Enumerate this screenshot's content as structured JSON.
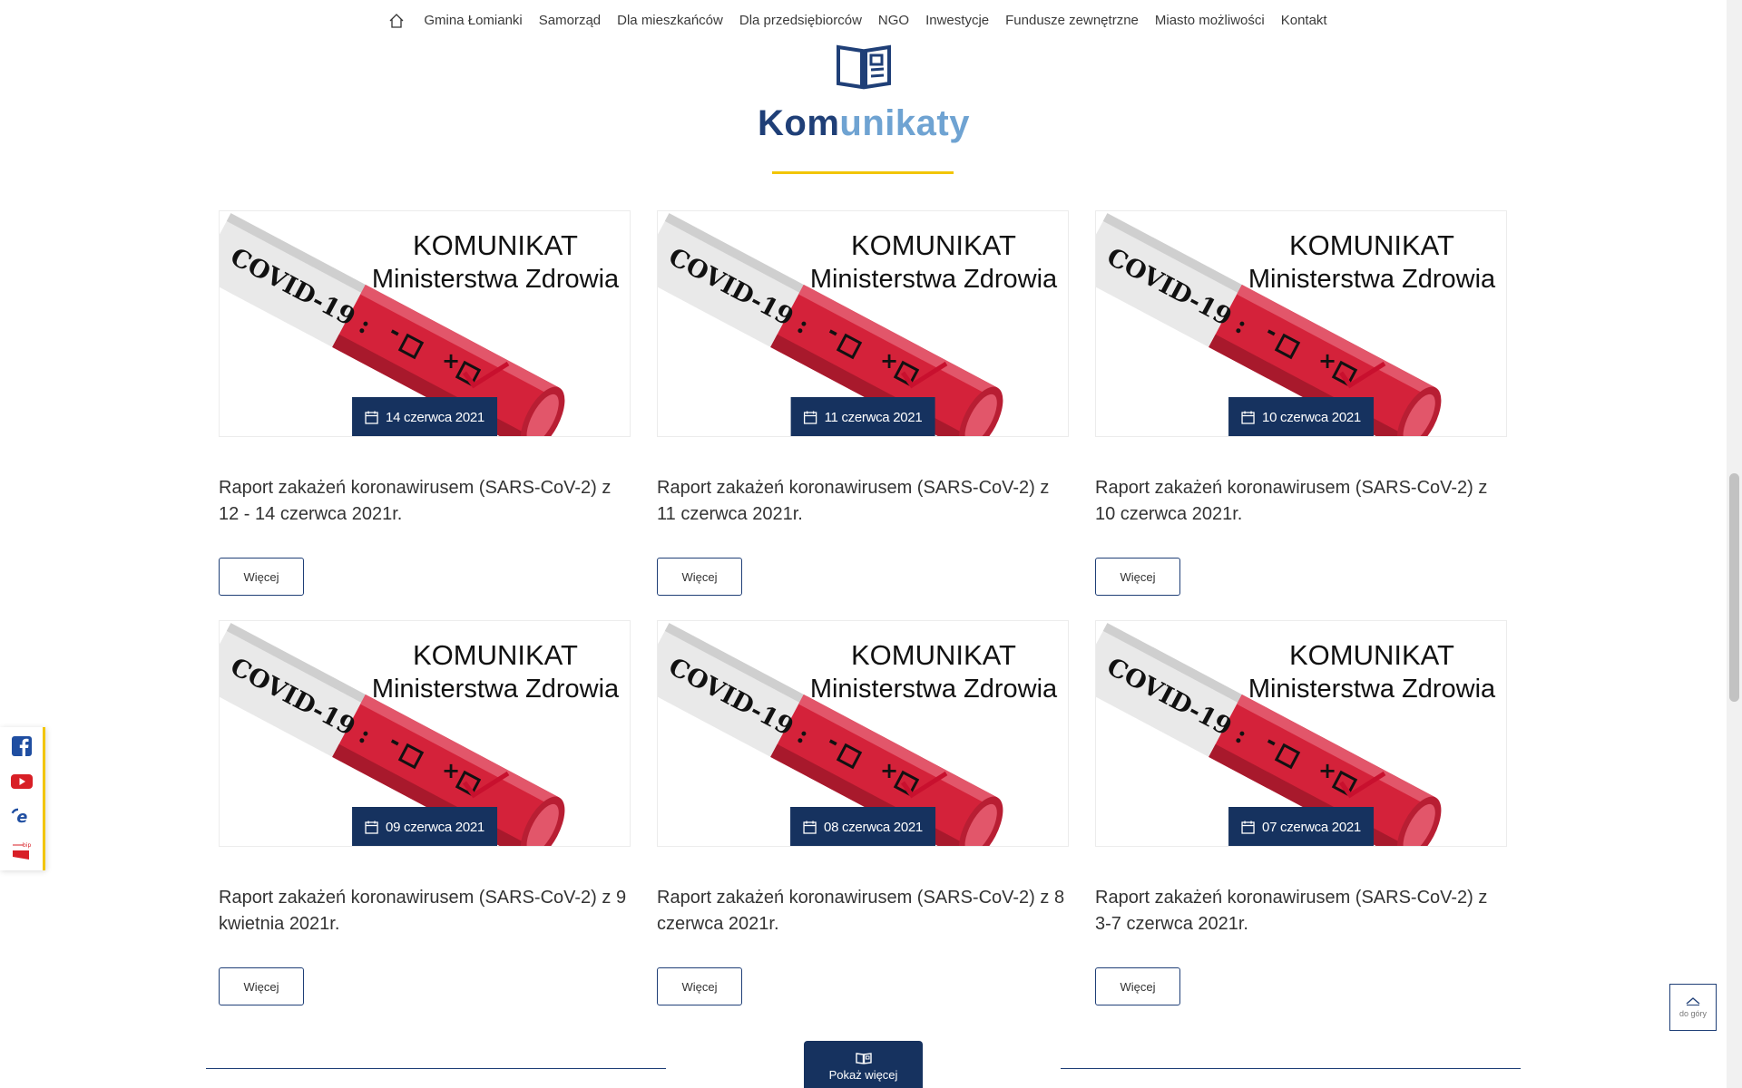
{
  "nav": {
    "items": [
      "Gmina Łomianki",
      "Samorząd",
      "Dla mieszkańców",
      "Dla przedsiębiorców",
      "NGO",
      "Inwestycje",
      "Fundusze zewnętrzne",
      "Miasto możliwości",
      "Kontakt"
    ]
  },
  "section": {
    "title_part1": "Kom",
    "title_part2": "unikaty"
  },
  "thumb_text": {
    "line1": "KOMUNIKAT",
    "line2": "Ministerstwa Zdrowia",
    "tube": "COVID-19 :",
    "neg": "-",
    "pos": "+"
  },
  "cards": [
    {
      "date": "14 czerwca 2021",
      "title": "Raport zakażeń koronawirusem (SARS-CoV-2) z 12 - 14 czerwca 2021r.",
      "button": "Więcej"
    },
    {
      "date": "11 czerwca 2021",
      "title": "Raport zakażeń koronawirusem (SARS-CoV-2) z 11 czerwca 2021r.",
      "button": "Więcej"
    },
    {
      "date": "10 czerwca 2021",
      "title": "Raport zakażeń koronawirusem (SARS-CoV-2) z 10 czerwca 2021r.",
      "button": "Więcej"
    },
    {
      "date": "09 czerwca 2021",
      "title": "Raport zakażeń koronawirusem (SARS-CoV-2) z 9 kwietnia 2021r.",
      "button": "Więcej"
    },
    {
      "date": "08 czerwca 2021",
      "title": "Raport zakażeń koronawirusem (SARS-CoV-2) z 8 czerwca 2021r.",
      "button": "Więcej"
    },
    {
      "date": "07 czerwca 2021",
      "title": "Raport zakażeń koronawirusem (SARS-CoV-2) z 3-7 czerwca 2021r.",
      "button": "Więcej"
    }
  ],
  "show_more": {
    "label": "Pokaż więcej"
  },
  "to_top": {
    "label": "do góry"
  },
  "social": {
    "items": [
      "facebook-icon",
      "youtube-icon",
      "epuap-icon",
      "bip-icon"
    ],
    "bip_text": "bip"
  },
  "colors": {
    "navy": "#16325f",
    "title_dark": "#1f3f77",
    "title_light": "#6fa3d2",
    "accent_yellow": "#f2c500",
    "tube_red": "#d4223a"
  }
}
